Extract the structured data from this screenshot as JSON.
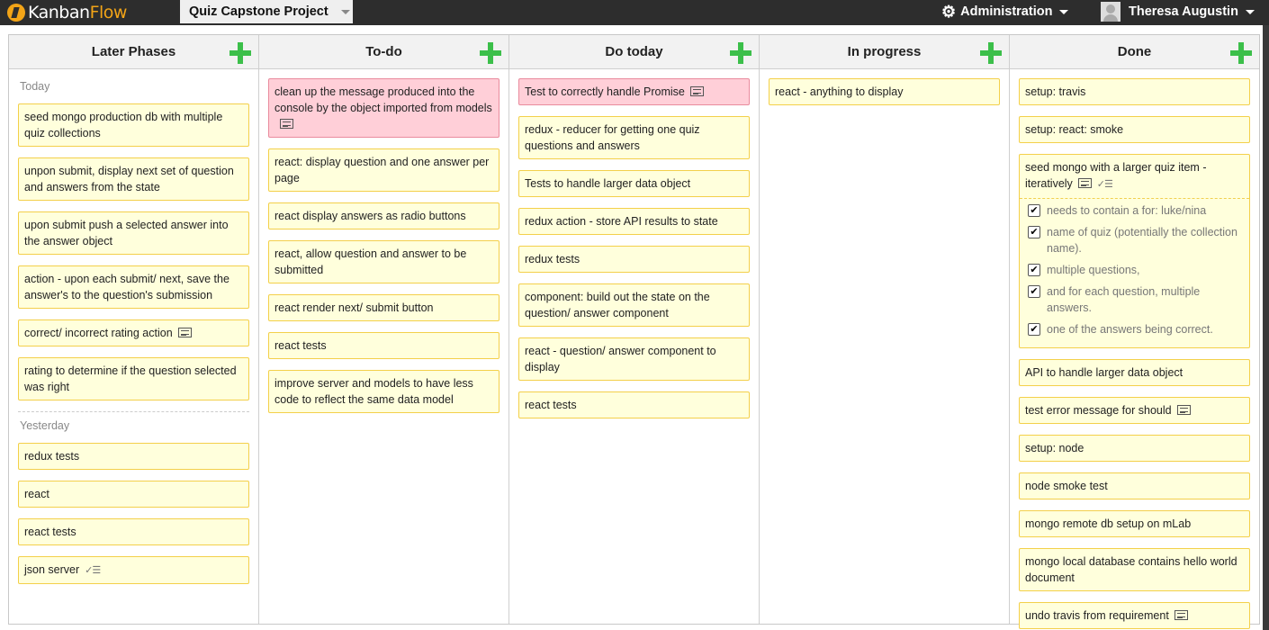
{
  "app": {
    "logo_a": "Kanban",
    "logo_b": "Flow",
    "board_name": "Quiz Capstone Project",
    "admin_label": "Administration",
    "user_name": "Theresa Augustin"
  },
  "colors": {
    "card_yellow": "#ffffdc",
    "card_red": "#ffcfd8",
    "add_green": "#3cbf4a"
  },
  "columns": [
    {
      "title": "Later Phases",
      "sections": [
        {
          "label": "Today",
          "cards": [
            {
              "text": "seed mongo production db with multiple quiz collections"
            },
            {
              "text": "unpon submit, display next set of question and answers from the state"
            },
            {
              "text": "upon submit push a selected answer into the answer object"
            },
            {
              "text": "action - upon each submit/ next, save the answer's to the question's submission"
            },
            {
              "text": "correct/ incorrect rating action",
              "note": true
            },
            {
              "text": "rating to determine if the question selected was right"
            }
          ]
        },
        {
          "label": "Yesterday",
          "cards": [
            {
              "text": "redux tests"
            },
            {
              "text": "react"
            },
            {
              "text": "react tests"
            },
            {
              "text": "json server",
              "checklist": true
            }
          ]
        }
      ]
    },
    {
      "title": "To-do",
      "sections": [
        {
          "cards": [
            {
              "text": "clean up the message produced into the console by the object imported from models",
              "note": true,
              "color": "red"
            },
            {
              "text": "react: display question and one answer per page"
            },
            {
              "text": "react display answers as radio buttons"
            },
            {
              "text": "react, allow question and answer to be submitted"
            },
            {
              "text": "react render next/ submit button"
            },
            {
              "text": "react tests"
            },
            {
              "text": "improve server and models to have less code to reflect the same data model"
            }
          ]
        }
      ]
    },
    {
      "title": "Do today",
      "sections": [
        {
          "cards": [
            {
              "text": "Test to correctly handle Promise",
              "note": true,
              "color": "red"
            },
            {
              "text": "redux - reducer for getting one quiz questions and answers"
            },
            {
              "text": "Tests to handle larger data object"
            },
            {
              "text": "redux action - store API results to state"
            },
            {
              "text": "redux tests"
            },
            {
              "text": "component: build out the state on the question/ answer component"
            },
            {
              "text": "react - question/ answer component to display"
            },
            {
              "text": "react tests"
            }
          ]
        }
      ]
    },
    {
      "title": "In progress",
      "sections": [
        {
          "cards": [
            {
              "text": "react - anything to display"
            }
          ]
        }
      ]
    },
    {
      "title": "Done",
      "sections": [
        {
          "cards": [
            {
              "text": "setup: travis"
            },
            {
              "text": "setup: react: smoke"
            },
            {
              "text": "seed mongo with a larger quiz item - iteratively",
              "note": true,
              "checklist": true,
              "subtasks": [
                {
                  "text": "needs to contain a for: luke/nina",
                  "done": true
                },
                {
                  "text": "name of quiz (potentially the collection name).",
                  "done": true
                },
                {
                  "text": "multiple questions,",
                  "done": true
                },
                {
                  "text": "and for each question, multiple answers.",
                  "done": true
                },
                {
                  "text": "one of the answers being correct.",
                  "done": true
                }
              ]
            },
            {
              "text": "API to handle larger data object"
            },
            {
              "text": "test error message for should",
              "note": true
            },
            {
              "text": "setup: node"
            },
            {
              "text": "node smoke test"
            },
            {
              "text": "mongo remote db setup on mLab"
            },
            {
              "text": "mongo local database contains hello world document"
            },
            {
              "text": "undo travis from requirement",
              "note": true
            }
          ]
        }
      ]
    }
  ]
}
